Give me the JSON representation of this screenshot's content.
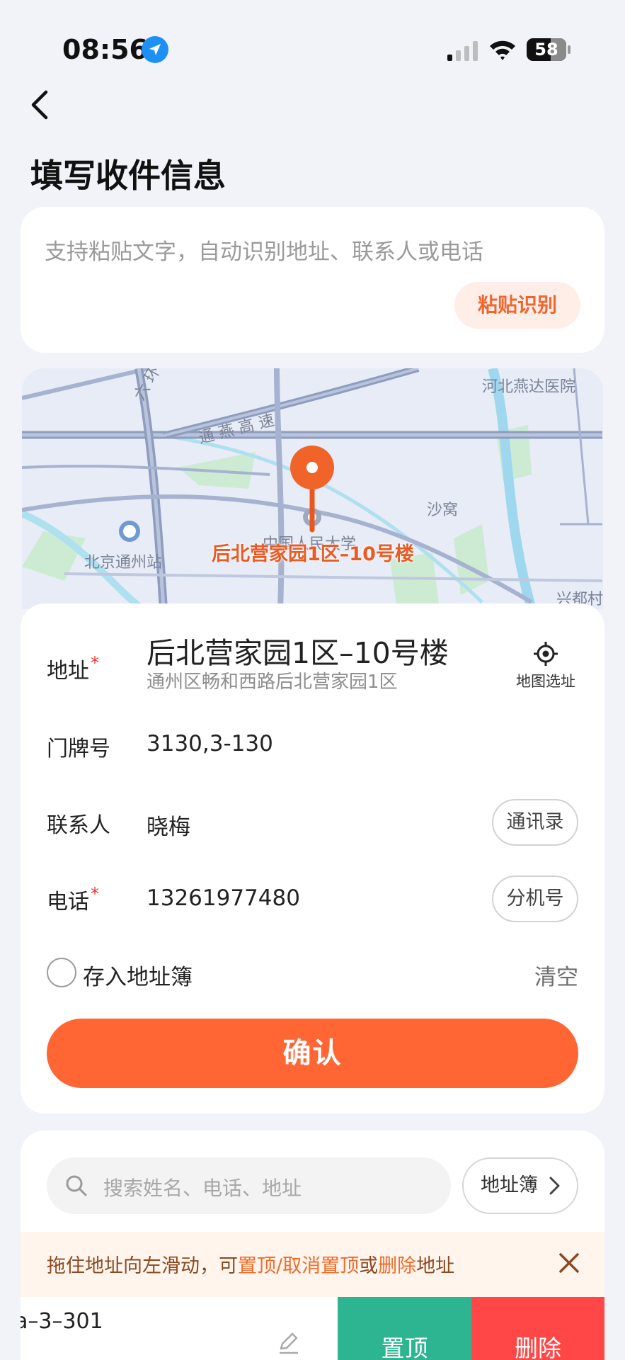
{
  "status_bar": {
    "time": "08:56",
    "battery_level": "58",
    "icons": [
      "location-arrow-icon",
      "signal-icon",
      "wifi-icon",
      "battery-icon"
    ]
  },
  "header": {
    "back_icon": "chevron-left-icon",
    "title": "填写收件信息"
  },
  "paste": {
    "placeholder": "支持粘贴文字，自动识别地址、联系人或电话",
    "button_label": "粘贴识别"
  },
  "map": {
    "pin_label": "后北营家园1区–10号楼",
    "places": {
      "hospital": "河北燕达医院",
      "road": "通 燕 高 速",
      "village": "沙窝",
      "station": "北京通州站",
      "university": "中国人民大学",
      "ring": "六 环",
      "xingdu": "兴都村"
    }
  },
  "form": {
    "address": {
      "label": "地址",
      "required_mark": "*",
      "main": "后北营家园1区–10号楼",
      "sub": "通州区畅和西路后北营家园1区",
      "map_select_label": "地图选址"
    },
    "door": {
      "label": "门牌号",
      "value": "3130,3-130"
    },
    "contact": {
      "label": "联系人",
      "value": "晓梅",
      "button": "通讯录"
    },
    "phone": {
      "label": "电话",
      "required_mark": "*",
      "value": "13261977480",
      "button": "分机号"
    },
    "save_to_book": {
      "label": "存入地址簿",
      "checked": false
    },
    "clear_label": "清空",
    "confirm_label": "确认"
  },
  "address_book": {
    "search_placeholder": "搜索姓名、电话、地址",
    "book_button": "地址簿",
    "tip": {
      "part1": "拖住地址向左滑动，可",
      "highlight1": "置顶/取消置顶",
      "part2": "或",
      "highlight2": "删除",
      "part3": "地址"
    },
    "partial_item": "a–3–301",
    "pin_button": "置顶",
    "delete_button": "删除"
  },
  "colors": {
    "accent": "#FF6633",
    "pin_green": "#2CB590",
    "delete_red": "#FF4747",
    "required_red": "#E53935"
  }
}
